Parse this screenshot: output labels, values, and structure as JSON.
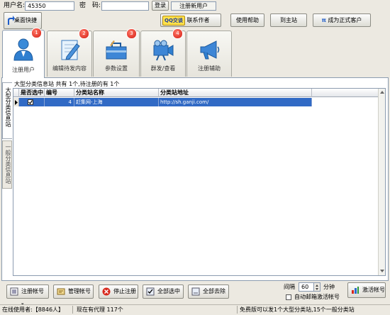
{
  "login": {
    "username_label": "用户名:",
    "username_value": "45350",
    "password_label": "密　码:",
    "password_value": "",
    "login_button": "登录",
    "register_link": "注册新用户"
  },
  "top_buttons": {
    "desktop_shortcut": "桌面快捷",
    "qq_badge": "QQ交谈",
    "contact_author": "联系作者",
    "help": "使用帮助",
    "main_site": "到主站",
    "become_customer": "成为正式客户"
  },
  "tabs": [
    {
      "label": "注册用户",
      "badge": "1",
      "icon": "user-icon"
    },
    {
      "label": "编辑待发内容",
      "badge": "2",
      "icon": "edit-icon"
    },
    {
      "label": "参数设置",
      "badge": "3",
      "icon": "toolbox-icon"
    },
    {
      "label": "群发/查看",
      "badge": "4",
      "icon": "camera-icon"
    },
    {
      "label": "注册辅助",
      "badge": "",
      "icon": "megaphone-icon"
    }
  ],
  "side_tabs": {
    "large": "大型分类信息站",
    "general": "一般分类信息站"
  },
  "summary": "大型分类信息站 共有 1个,待注册的有 1个",
  "table": {
    "columns": [
      "是否选中",
      "编号",
      "分类站名称",
      "分类站地址"
    ],
    "rows": [
      {
        "selected": true,
        "id": "4",
        "name": "赶集网-上海",
        "url": "http://sh.ganji.com/"
      }
    ]
  },
  "bottom": {
    "register_account": "注册帐号",
    "manage_account": "管理帐号",
    "stop_register": "停止注册",
    "select_all": "全部选中",
    "deselect_all": "全部去除",
    "interval_label": "间隔",
    "interval_value": "60",
    "interval_unit": "分钟",
    "auto_email_label": "自动邮箱激活帐号",
    "activate_account": "激活帐号"
  },
  "statusbar": {
    "online_users": "在线使用者:【8846人】",
    "agents": "现在有代理 117个",
    "notice": "免费版可以发1个大型分类站,15个一般分类站"
  }
}
